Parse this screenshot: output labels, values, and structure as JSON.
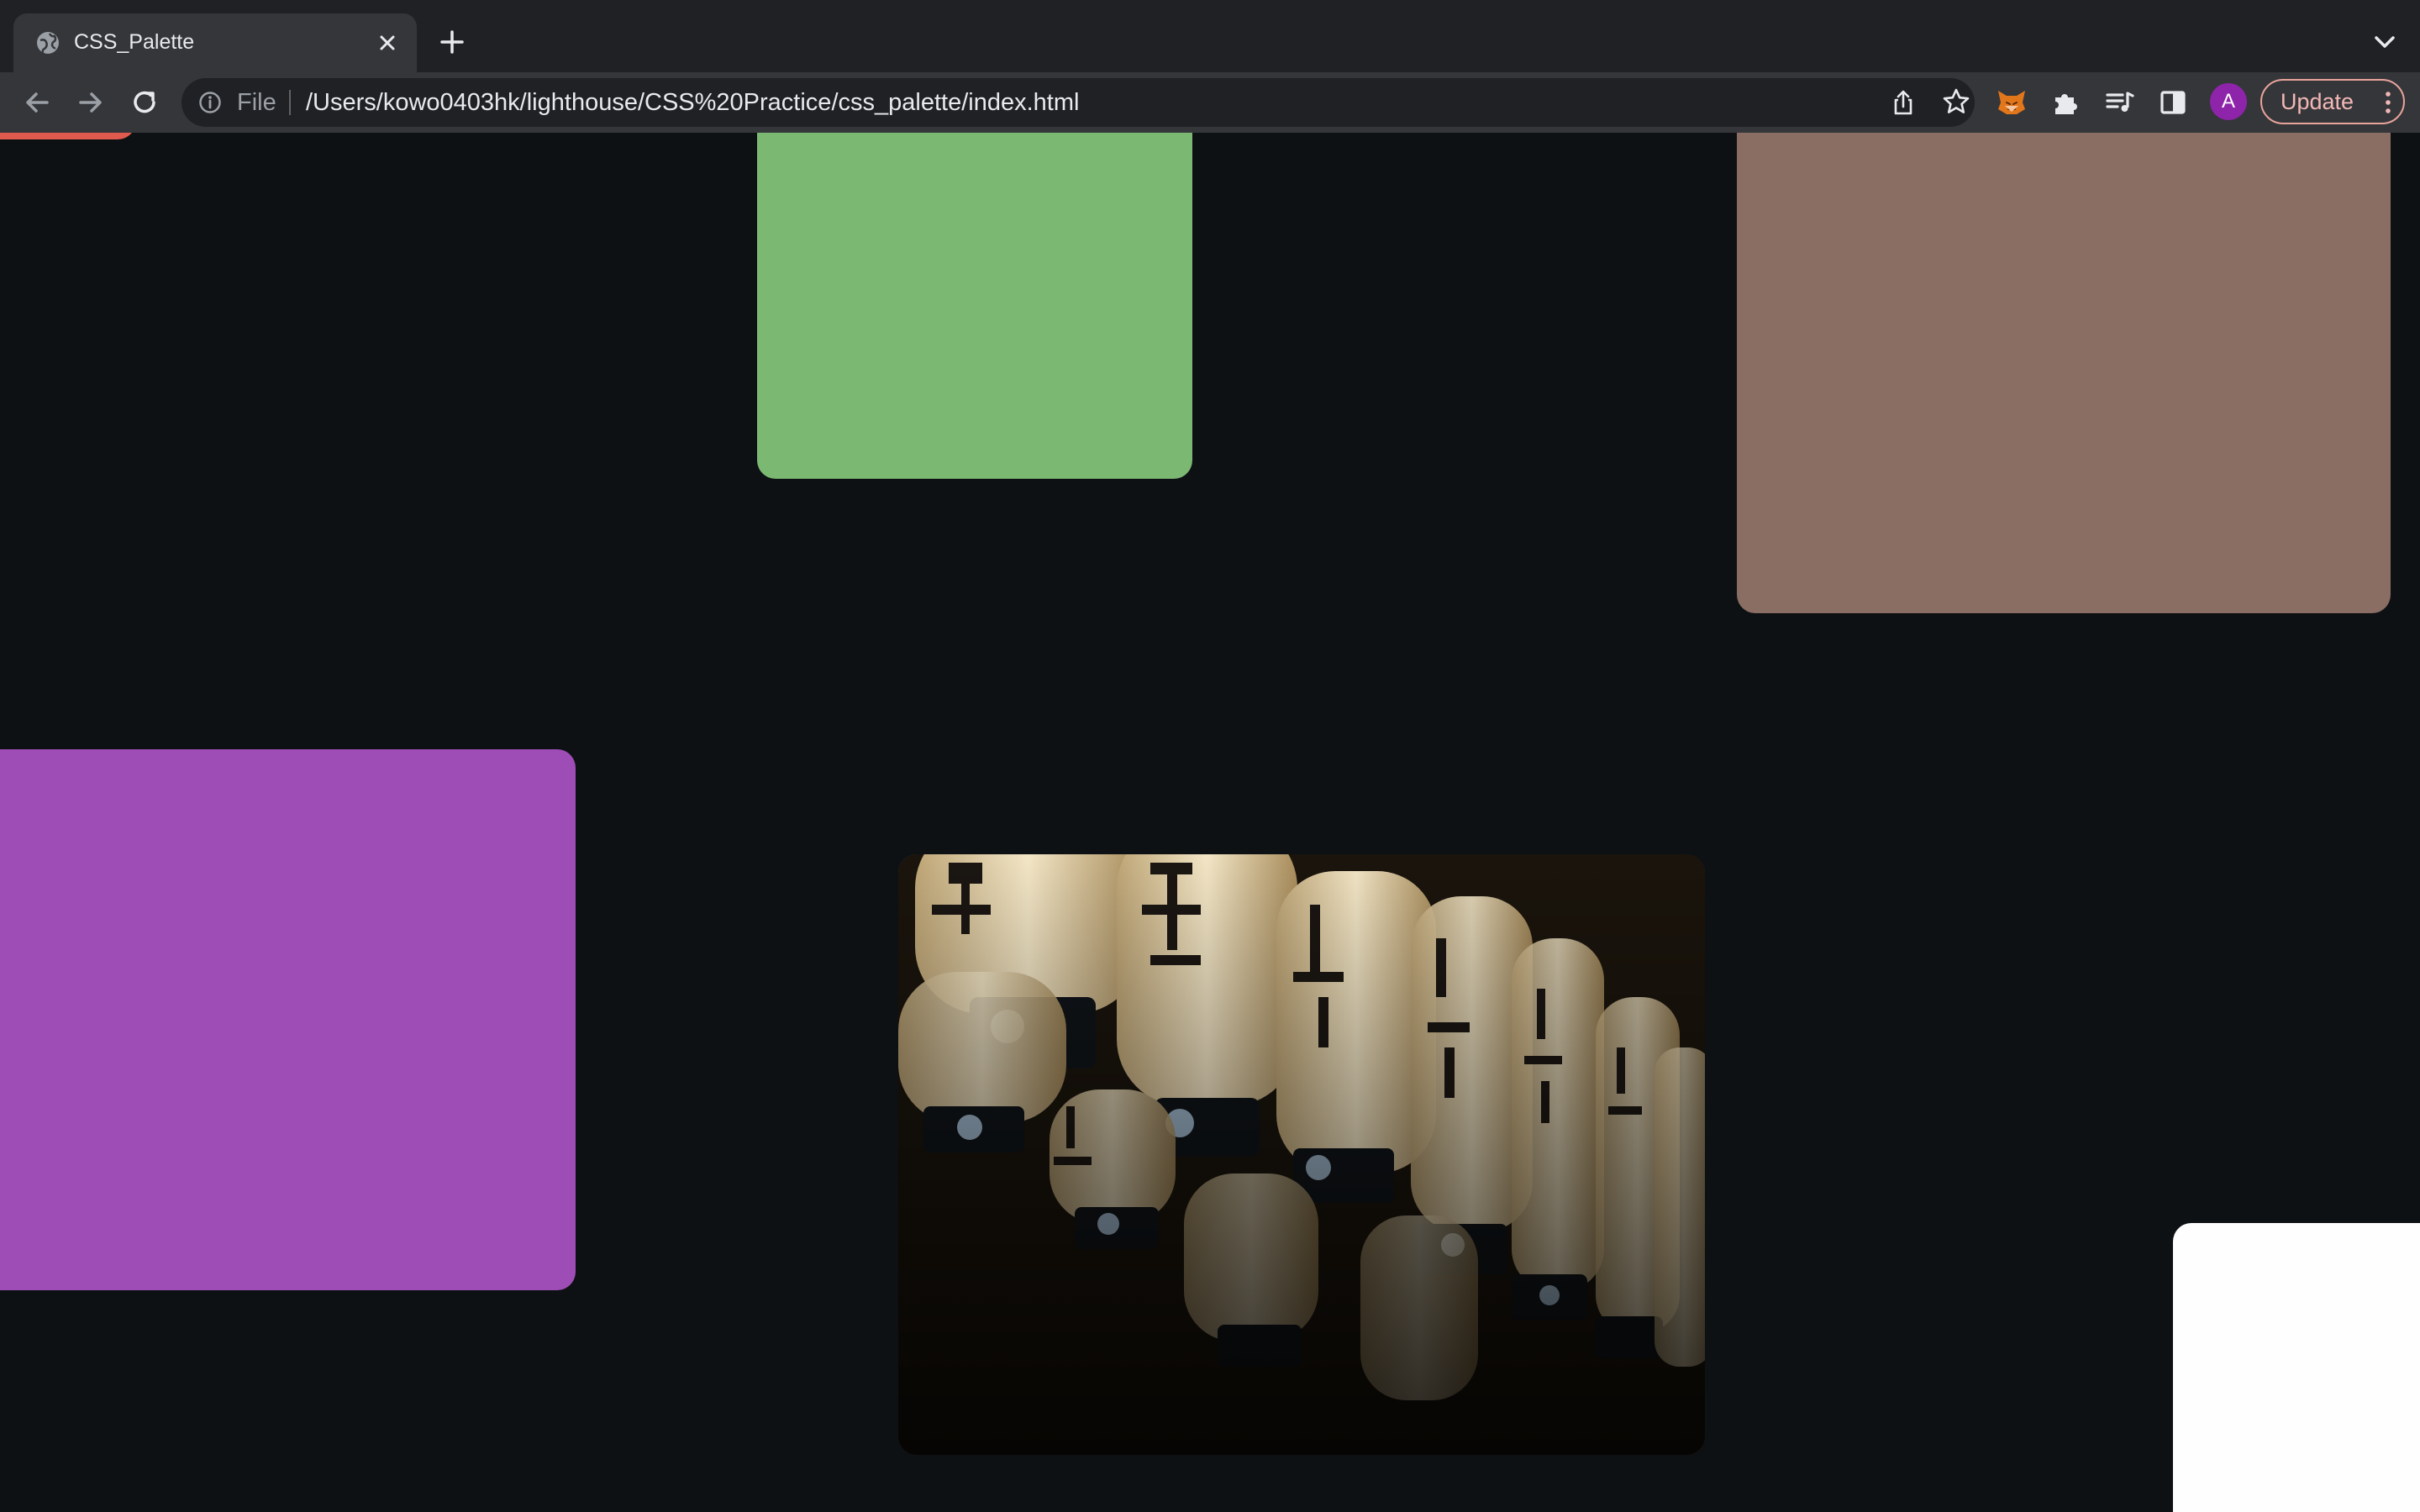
{
  "browser": {
    "tab": {
      "title": "CSS_Palette",
      "favicon": "globe-icon",
      "close": "close-icon"
    },
    "new_tab": "plus-icon",
    "tab_search": "chevron-down-icon",
    "omnibox": {
      "scheme": "File",
      "url": "/Users/kowo0403hk/lighthouse/CSS%20Practice/css_palette/index.html"
    },
    "profile_initial": "A",
    "update_label": "Update"
  },
  "page": {
    "background": "#0e1114",
    "swatches": [
      {
        "name": "red",
        "color": "#e05a4e"
      },
      {
        "name": "green",
        "color": "#7bb872"
      },
      {
        "name": "brown",
        "color": "#8a6e64"
      },
      {
        "name": "purple",
        "color": "#9f4db6"
      },
      {
        "name": "white",
        "color": "#fefefe"
      }
    ],
    "photo": {
      "subject": "paper lanterns with Japanese characters"
    }
  }
}
